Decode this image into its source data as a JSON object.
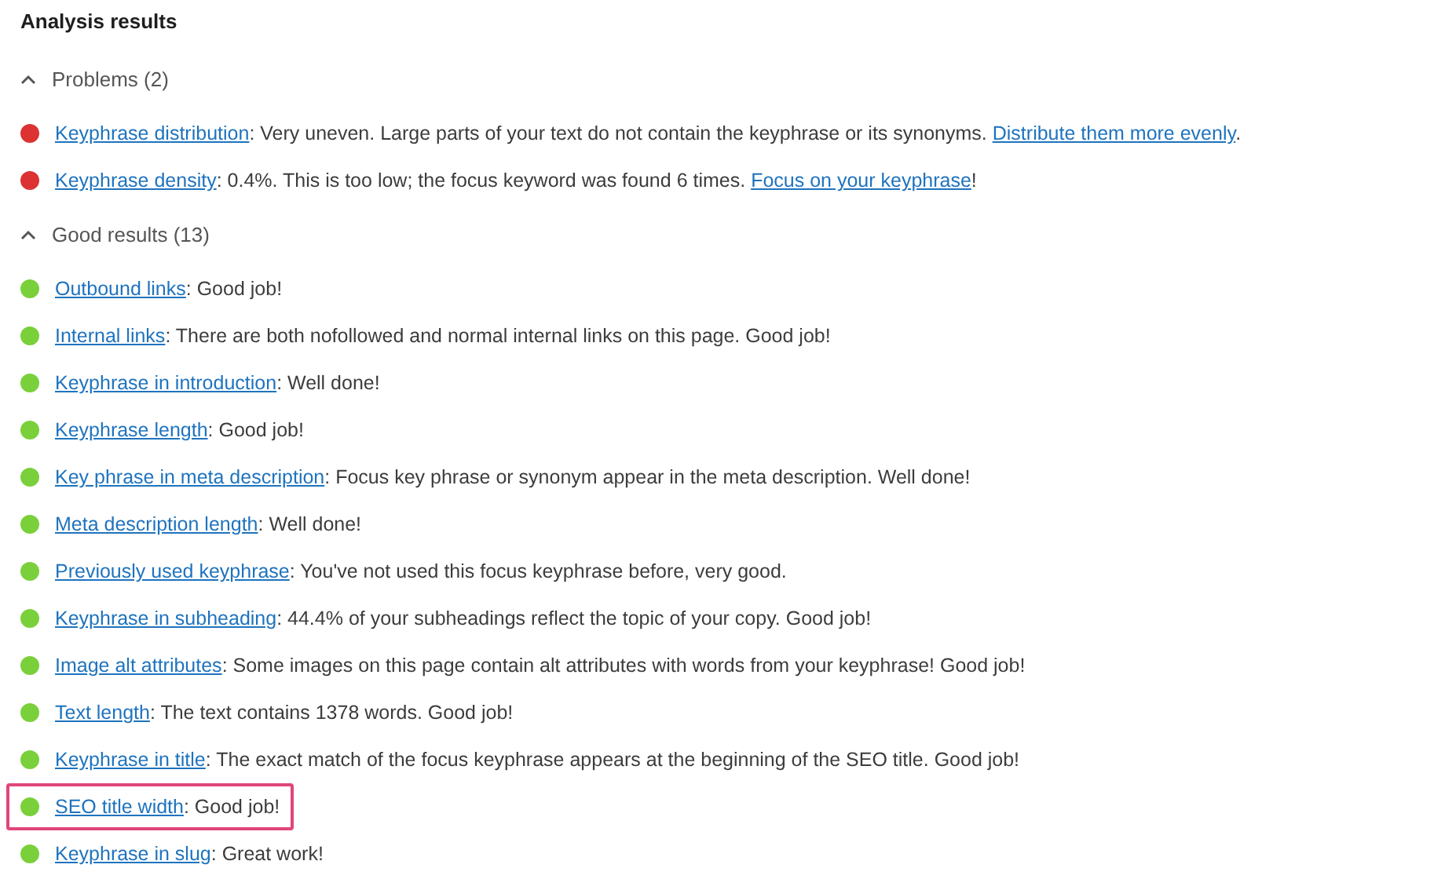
{
  "title": "Analysis results",
  "sections": [
    {
      "label": "Problems (2)",
      "expanded": true,
      "results": [
        {
          "color": "#dc3232",
          "highlighted": false,
          "parts": [
            {
              "kind": "link",
              "text": "Keyphrase distribution"
            },
            {
              "kind": "text",
              "text": ": Very uneven. Large parts of your text do not contain the keyphrase or its synonyms. "
            },
            {
              "kind": "link",
              "text": "Distribute them more evenly"
            },
            {
              "kind": "text",
              "text": "."
            }
          ]
        },
        {
          "color": "#dc3232",
          "highlighted": false,
          "parts": [
            {
              "kind": "link",
              "text": "Keyphrase density"
            },
            {
              "kind": "text",
              "text": ": 0.4%. This is too low; the focus keyword was found 6 times. "
            },
            {
              "kind": "link",
              "text": "Focus on your keyphrase"
            },
            {
              "kind": "text",
              "text": "!"
            }
          ]
        }
      ]
    },
    {
      "label": "Good results (13)",
      "expanded": true,
      "results": [
        {
          "color": "#7ad03a",
          "highlighted": false,
          "parts": [
            {
              "kind": "link",
              "text": "Outbound links"
            },
            {
              "kind": "text",
              "text": ": Good job!"
            }
          ]
        },
        {
          "color": "#7ad03a",
          "highlighted": false,
          "parts": [
            {
              "kind": "link",
              "text": "Internal links"
            },
            {
              "kind": "text",
              "text": ": There are both nofollowed and normal internal links on this page. Good job!"
            }
          ]
        },
        {
          "color": "#7ad03a",
          "highlighted": false,
          "parts": [
            {
              "kind": "link",
              "text": "Keyphrase in introduction"
            },
            {
              "kind": "text",
              "text": ": Well done!"
            }
          ]
        },
        {
          "color": "#7ad03a",
          "highlighted": false,
          "parts": [
            {
              "kind": "link",
              "text": "Keyphrase length"
            },
            {
              "kind": "text",
              "text": ": Good job!"
            }
          ]
        },
        {
          "color": "#7ad03a",
          "highlighted": false,
          "parts": [
            {
              "kind": "link",
              "text": "Key phrase in meta description"
            },
            {
              "kind": "text",
              "text": ": Focus key phrase or synonym appear in the meta description. Well done!"
            }
          ]
        },
        {
          "color": "#7ad03a",
          "highlighted": false,
          "parts": [
            {
              "kind": "link",
              "text": "Meta description length"
            },
            {
              "kind": "text",
              "text": ": Well done!"
            }
          ]
        },
        {
          "color": "#7ad03a",
          "highlighted": false,
          "parts": [
            {
              "kind": "link",
              "text": "Previously used keyphrase"
            },
            {
              "kind": "text",
              "text": ": You've not used this focus keyphrase before, very good."
            }
          ]
        },
        {
          "color": "#7ad03a",
          "highlighted": false,
          "parts": [
            {
              "kind": "link",
              "text": "Keyphrase in subheading"
            },
            {
              "kind": "text",
              "text": ": 44.4% of your subheadings reflect the topic of your copy. Good job!"
            }
          ]
        },
        {
          "color": "#7ad03a",
          "highlighted": false,
          "parts": [
            {
              "kind": "link",
              "text": "Image alt attributes"
            },
            {
              "kind": "text",
              "text": ": Some images on this page contain alt attributes with words from your keyphrase! Good job!"
            }
          ]
        },
        {
          "color": "#7ad03a",
          "highlighted": false,
          "parts": [
            {
              "kind": "link",
              "text": "Text length"
            },
            {
              "kind": "text",
              "text": ": The text contains 1378 words. Good job!"
            }
          ]
        },
        {
          "color": "#7ad03a",
          "highlighted": false,
          "parts": [
            {
              "kind": "link",
              "text": "Keyphrase in title"
            },
            {
              "kind": "text",
              "text": ": The exact match of the focus keyphrase appears at the beginning of the SEO title. Good job!"
            }
          ]
        },
        {
          "color": "#7ad03a",
          "highlighted": true,
          "parts": [
            {
              "kind": "link",
              "text": "SEO title width"
            },
            {
              "kind": "text",
              "text": ": Good job!"
            }
          ]
        },
        {
          "color": "#7ad03a",
          "highlighted": false,
          "parts": [
            {
              "kind": "link",
              "text": "Keyphrase in slug"
            },
            {
              "kind": "text",
              "text": ": Great work!"
            }
          ]
        }
      ]
    }
  ]
}
